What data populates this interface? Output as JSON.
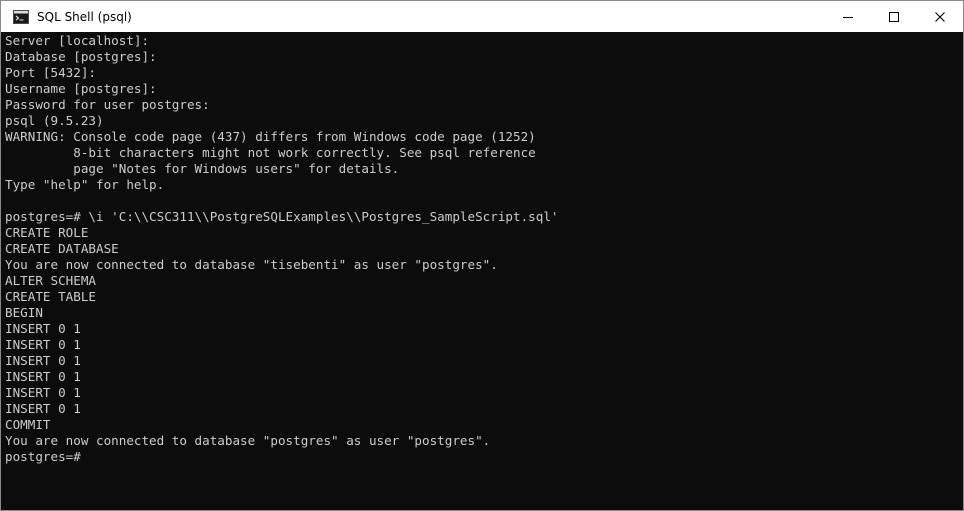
{
  "window": {
    "title": "SQL Shell (psql)"
  },
  "icons": {
    "app": "console-icon",
    "minimize": "minimize-icon",
    "maximize": "maximize-icon",
    "close": "close-icon"
  },
  "colors": {
    "console_bg": "#0c0c0c",
    "console_fg": "#cccccc",
    "titlebar_bg": "#ffffff"
  },
  "console": {
    "lines": [
      "Server [localhost]:",
      "Database [postgres]:",
      "Port [5432]:",
      "Username [postgres]:",
      "Password for user postgres:",
      "psql (9.5.23)",
      "WARNING: Console code page (437) differs from Windows code page (1252)",
      "         8-bit characters might not work correctly. See psql reference",
      "         page \"Notes for Windows users\" for details.",
      "Type \"help\" for help.",
      "",
      "postgres=# \\i 'C:\\\\CSC311\\\\PostgreSQLExamples\\\\Postgres_SampleScript.sql'",
      "CREATE ROLE",
      "CREATE DATABASE",
      "You are now connected to database \"tisebenti\" as user \"postgres\".",
      "ALTER SCHEMA",
      "CREATE TABLE",
      "BEGIN",
      "INSERT 0 1",
      "INSERT 0 1",
      "INSERT 0 1",
      "INSERT 0 1",
      "INSERT 0 1",
      "INSERT 0 1",
      "COMMIT",
      "You are now connected to database \"postgres\" as user \"postgres\".",
      "postgres=#"
    ]
  }
}
